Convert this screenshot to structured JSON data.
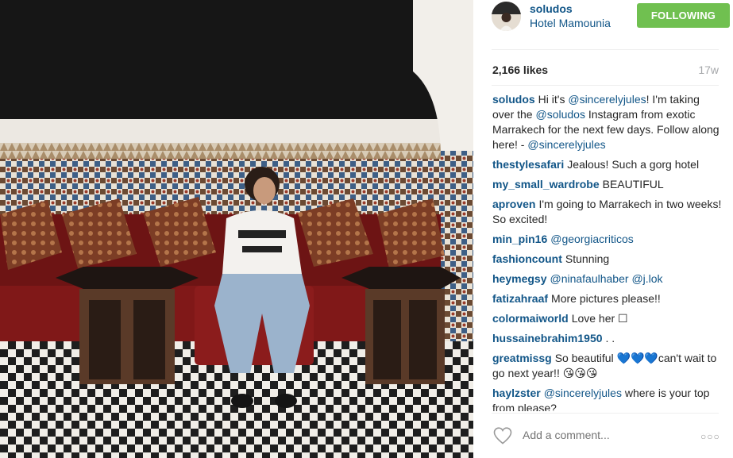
{
  "header": {
    "username": "soludos",
    "location": "Hotel Mamounia",
    "follow_label": "FOLLOWING"
  },
  "stats": {
    "likes": "2,166 likes",
    "age": "17w"
  },
  "caption": {
    "user": "soludos",
    "parts": [
      {
        "t": "Hi it's ",
        "m": false
      },
      {
        "t": "@sincerelyjules",
        "m": true
      },
      {
        "t": "! I'm taking over the ",
        "m": false
      },
      {
        "t": "@soludos",
        "m": true
      },
      {
        "t": " Instagram from exotic Marrakech for the next few days. Follow along here! - ",
        "m": false
      },
      {
        "t": "@sincerelyjules",
        "m": true
      }
    ]
  },
  "comments": [
    {
      "user": "thestylesafari",
      "parts": [
        {
          "t": "Jealous! Such a gorg hotel",
          "m": false
        }
      ]
    },
    {
      "user": "my_small_wardrobe",
      "parts": [
        {
          "t": "BEAUTIFUL",
          "m": false
        }
      ]
    },
    {
      "user": "aproven",
      "parts": [
        {
          "t": "I'm going to Marrakech in two weeks! So excited!",
          "m": false
        }
      ]
    },
    {
      "user": "min_pin16",
      "parts": [
        {
          "t": "@georgiacriticos",
          "m": true
        }
      ]
    },
    {
      "user": "fashioncount",
      "parts": [
        {
          "t": "Stunning",
          "m": false
        }
      ]
    },
    {
      "user": "heymegsy",
      "parts": [
        {
          "t": "@ninafaulhaber",
          "m": true
        },
        {
          "t": " ",
          "m": false
        },
        {
          "t": "@j.lok",
          "m": true
        }
      ]
    },
    {
      "user": "fatizahraaf",
      "parts": [
        {
          "t": "More pictures please!!",
          "m": false
        }
      ]
    },
    {
      "user": "colormaiworld",
      "parts": [
        {
          "t": "Love her ☐",
          "m": false
        }
      ]
    },
    {
      "user": "hussainebrahim1950",
      "parts": [
        {
          "t": ". .",
          "m": false
        }
      ]
    },
    {
      "user": "greatmissg",
      "parts": [
        {
          "t": "So beautiful 💙💙💙can't wait to go next year!! 😘😘😘",
          "m": false
        }
      ]
    },
    {
      "user": "haylzster",
      "parts": [
        {
          "t": "@sincerelyjules",
          "m": true
        },
        {
          "t": " where is your top from please?",
          "m": false
        }
      ]
    }
  ],
  "footer": {
    "add_comment_placeholder": "Add a comment...",
    "more_label": "○○○"
  },
  "colors": {
    "link": "#125688",
    "follow_bg": "#70c050",
    "muted": "#a5a7aa"
  }
}
